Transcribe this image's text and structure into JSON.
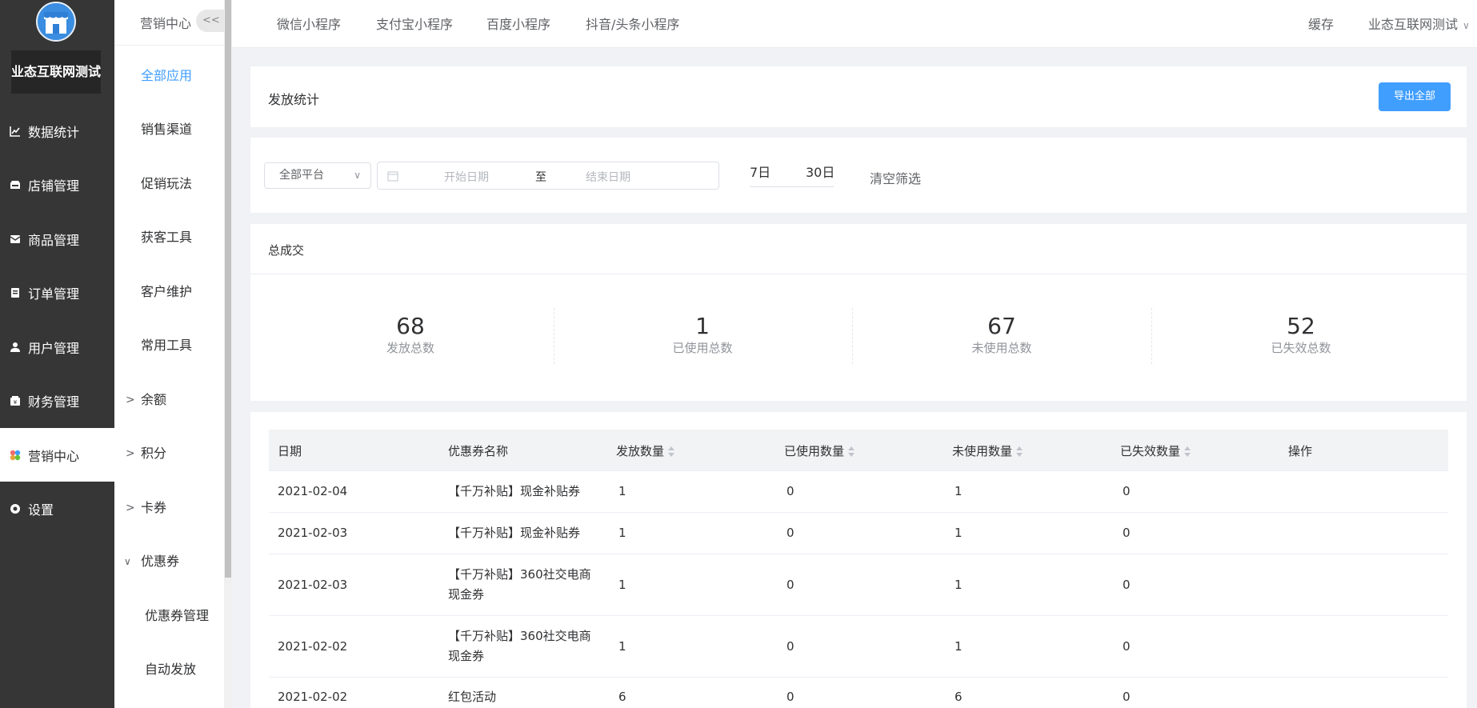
{
  "sidebar": {
    "shop_name": "业态互联网测试",
    "items": [
      {
        "label": "数据统计",
        "icon": "line-chart-icon"
      },
      {
        "label": "店铺管理",
        "icon": "shop-icon"
      },
      {
        "label": "商品管理",
        "icon": "box-icon"
      },
      {
        "label": "订单管理",
        "icon": "clipboard-icon"
      },
      {
        "label": "用户管理",
        "icon": "user-icon"
      },
      {
        "label": "财务管理",
        "icon": "wallet-icon"
      },
      {
        "label": "营销中心",
        "icon": "marketing-icon",
        "active": true
      },
      {
        "label": "设置",
        "icon": "gear-icon"
      }
    ]
  },
  "subnav": {
    "title": "营销中心",
    "collapse_label": "<<",
    "items": [
      {
        "label": "全部应用"
      },
      {
        "label": "销售渠道"
      },
      {
        "label": "促销玩法"
      },
      {
        "label": "获客工具"
      },
      {
        "label": "客户维护"
      },
      {
        "label": "常用工具"
      },
      {
        "label": "余额",
        "arrow": ">"
      },
      {
        "label": "积分",
        "arrow": ">"
      },
      {
        "label": "卡券",
        "arrow": ">"
      },
      {
        "label": "优惠券",
        "arrow": "∨"
      },
      {
        "label": "优惠券管理"
      },
      {
        "label": "自动发放"
      }
    ]
  },
  "topbar": {
    "tabs": [
      "微信小程序",
      "支付宝小程序",
      "百度小程序",
      "抖音/头条小程序"
    ],
    "cache_label": "缓存",
    "user_label": "业态互联网测试"
  },
  "header": {
    "title": "发放统计",
    "export_label": "导出全部"
  },
  "filters": {
    "platform": "全部平台",
    "start_placeholder": "开始日期",
    "range_separator": "至",
    "end_placeholder": "结束日期",
    "quick_7": "7日",
    "quick_30": "30日",
    "clear_label": "清空筛选"
  },
  "summary": {
    "title": "总成交",
    "stats": [
      {
        "value": "68",
        "label": "发放总数"
      },
      {
        "value": "1",
        "label": "已使用总数"
      },
      {
        "value": "67",
        "label": "未使用总数"
      },
      {
        "value": "52",
        "label": "已失效总数"
      }
    ]
  },
  "table": {
    "columns": [
      "日期",
      "优惠券名称",
      "发放数量",
      "已使用数量",
      "未使用数量",
      "已失效数量",
      "操作"
    ],
    "rows": [
      {
        "date": "2021-02-04",
        "name1": "【千万补贴】现金补贴券",
        "name2": "",
        "issued": "1",
        "used": "0",
        "unused": "1",
        "expired": "0"
      },
      {
        "date": "2021-02-03",
        "name1": "【千万补贴】现金补贴券",
        "name2": "",
        "issued": "1",
        "used": "0",
        "unused": "1",
        "expired": "0"
      },
      {
        "date": "2021-02-03",
        "name1": "【千万补贴】360社交电商",
        "name2": "现金券",
        "issued": "1",
        "used": "0",
        "unused": "1",
        "expired": "0"
      },
      {
        "date": "2021-02-02",
        "name1": "【千万补贴】360社交电商",
        "name2": "现金券",
        "issued": "1",
        "used": "0",
        "unused": "1",
        "expired": "0"
      },
      {
        "date": "2021-02-02",
        "name1": "红包活动",
        "name2": "",
        "issued": "6",
        "used": "0",
        "unused": "6",
        "expired": "0"
      }
    ]
  }
}
